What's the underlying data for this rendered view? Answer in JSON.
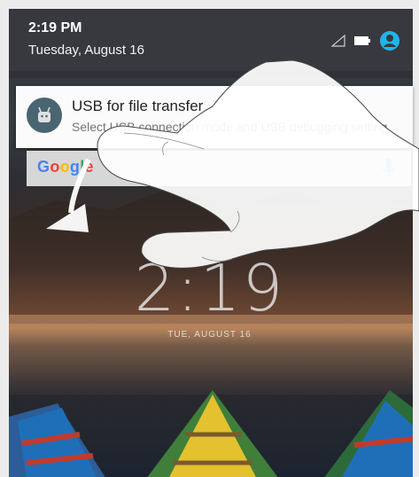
{
  "status_bar": {
    "time": "2:19 PM",
    "date": "Tuesday, August 16",
    "icons": [
      "signal-icon",
      "battery-icon",
      "user-avatar-icon"
    ],
    "accent_color": "#1fb6e8"
  },
  "notification": {
    "icon": "android-debug-icon",
    "title": "USB for file transfer",
    "text": "Select USB connection mode and USB debugging setting"
  },
  "search_bar": {
    "logo_text": "Google",
    "mic_icon": "mic-icon",
    "mic_color": "#4285f4"
  },
  "lock_clock": {
    "time": "2:19",
    "date": "TUE, AUGUST 16"
  },
  "gesture_overlay": {
    "hand_icon": "swipe-hand-icon",
    "arrow_icon": "swipe-down-arrow-icon"
  }
}
